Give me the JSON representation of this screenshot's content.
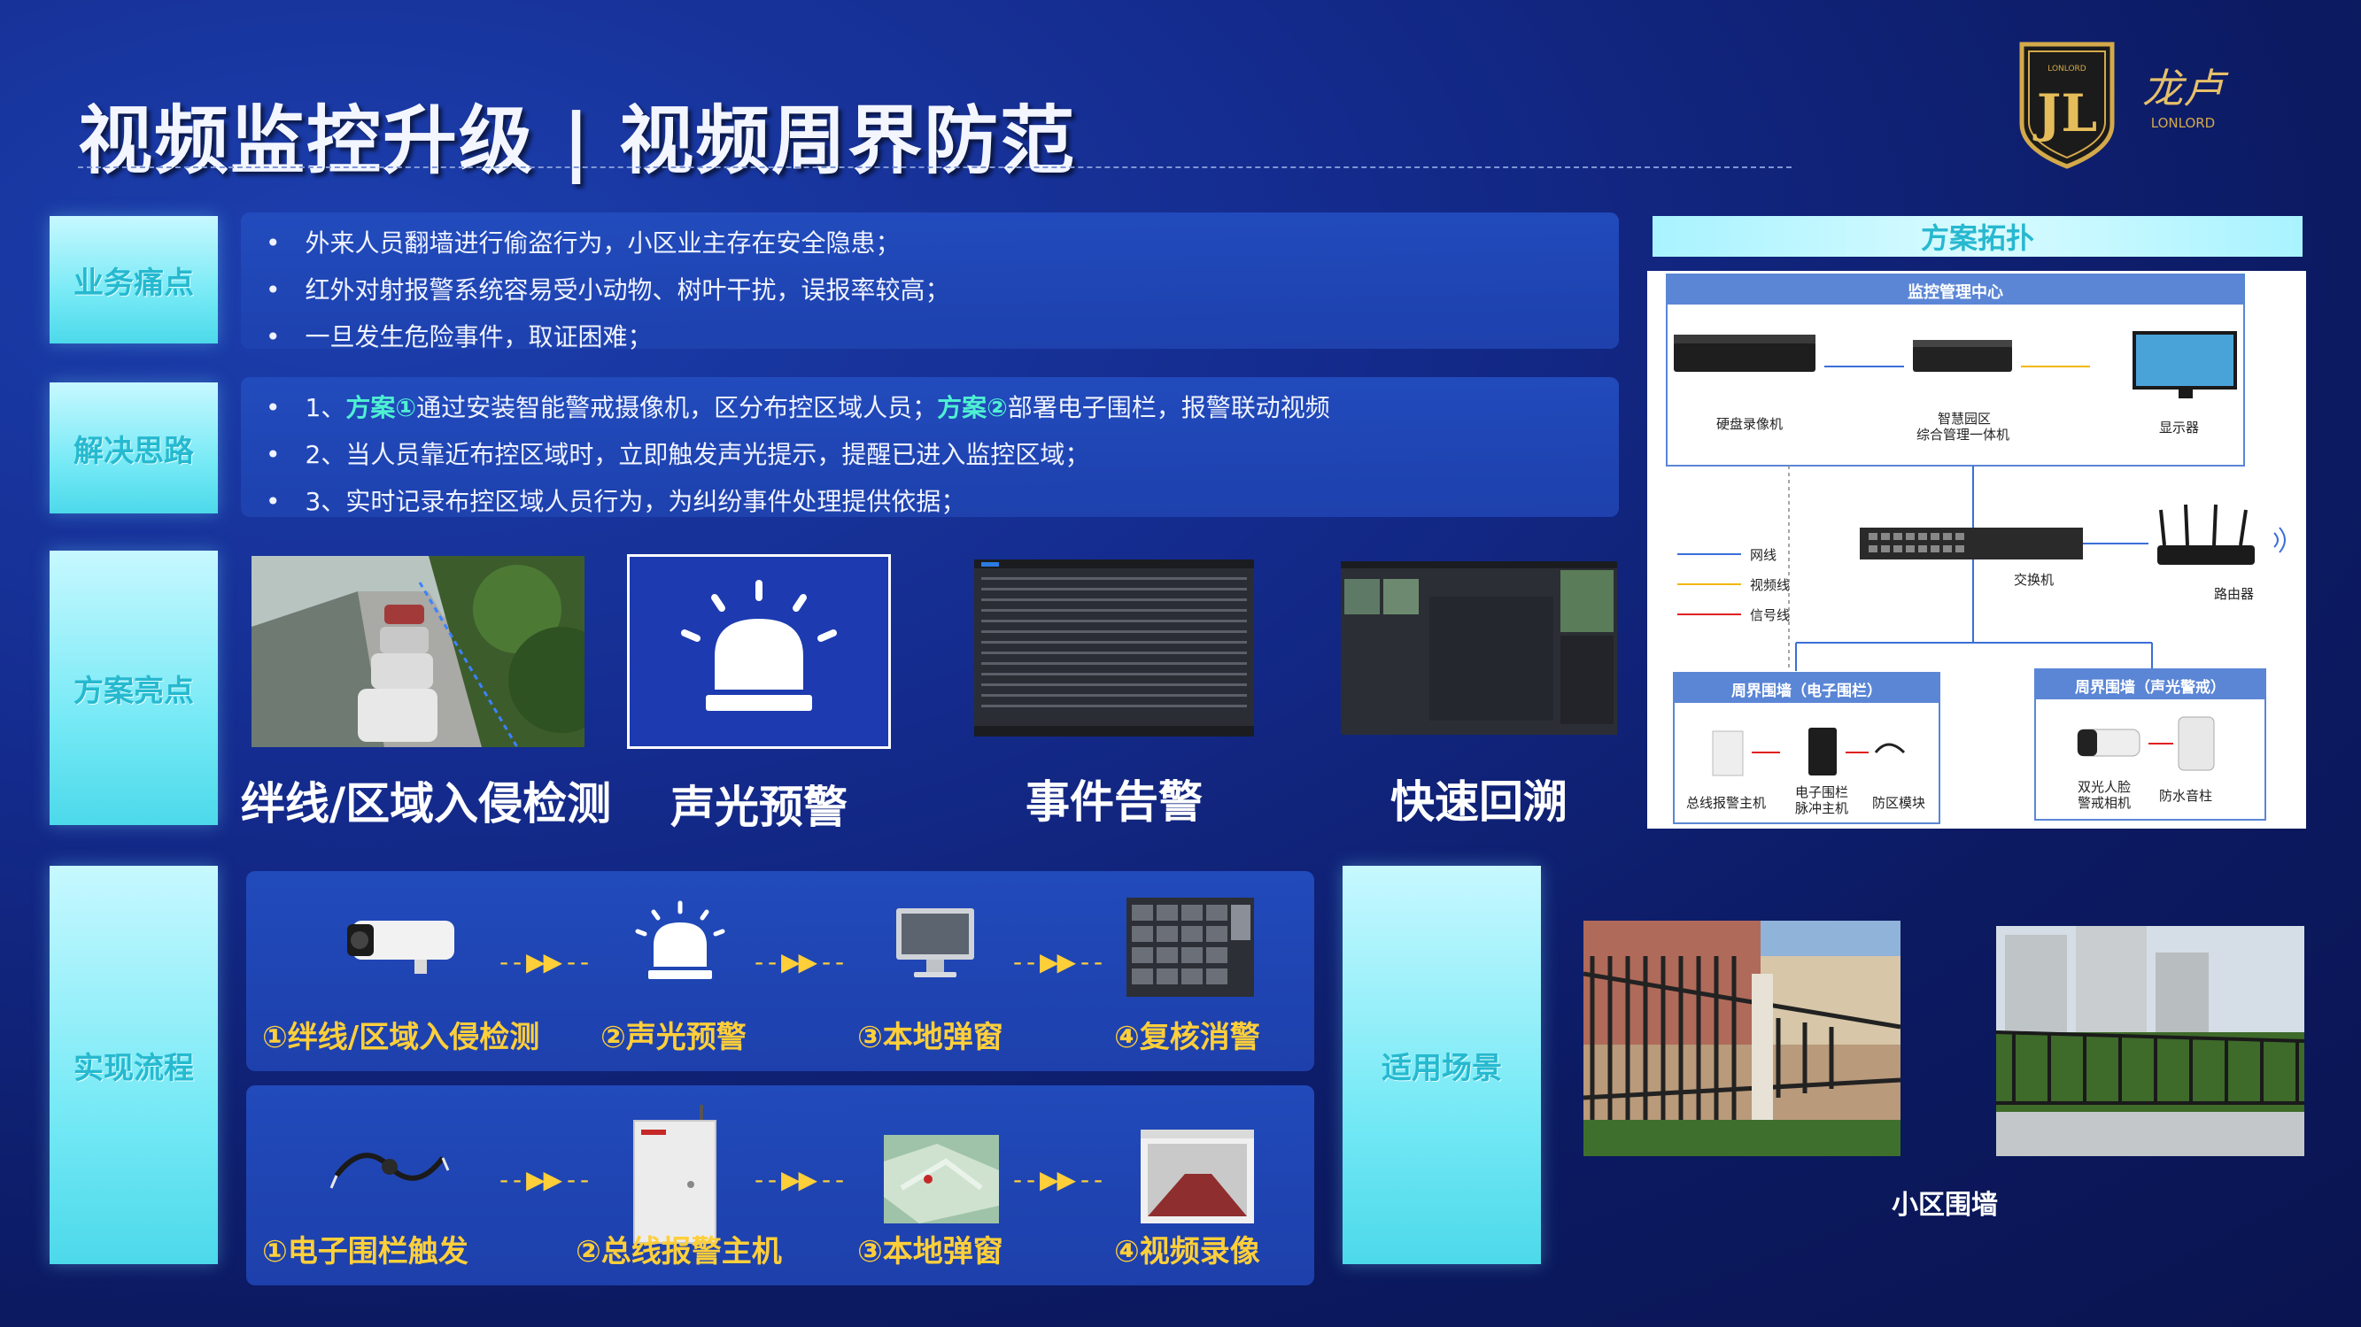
{
  "title": "视频监控升级 | 视频周界防范",
  "logo": {
    "mark": "JL",
    "brand_top": "LONLORD",
    "brand_cn": "龙卢",
    "brand_bottom": "LONLORD"
  },
  "pain_points": {
    "label": "业务痛点",
    "items": [
      "外来人员翻墙进行偷盗行为，小区业主存在安全隐患；",
      "红外对射报警系统容易受小动物、树叶干扰，误报率较高；",
      "一旦发生危险事件，取证困难；"
    ]
  },
  "solution": {
    "label": "解决思路",
    "item1_prefix": "1、",
    "item1_hl1": "方案①",
    "item1_mid": "通过安装智能警戒摄像机，区分布控区域人员；",
    "item1_hl2": "方案②",
    "item1_tail": "部署电子围栏，报警联动视频",
    "item2": "2、当人员靠近布控区域时，立即触发声光提示，提醒已进入监控区域；",
    "item3": "3、实时记录布控区域人员行为，为纠纷事件处理提供依据；"
  },
  "highlights": {
    "label": "方案亮点",
    "items": [
      "绊线/区域入侵检测",
      "声光预警",
      "事件告警",
      "快速回溯"
    ]
  },
  "process": {
    "label": "实现流程",
    "row1": [
      "①绊线/区域入侵检测",
      "②声光预警",
      "③本地弹窗",
      "④复核消警"
    ],
    "row2": [
      "①电子围栏触发",
      "②总线报警主机",
      "③本地弹窗",
      "④视频录像"
    ],
    "arrow": "- - ▶▶ - -"
  },
  "scenes": {
    "label": "适用场景",
    "caption": "小区围墙"
  },
  "topology": {
    "header": "方案拓扑",
    "center_title": "监控管理中心",
    "nvr": "硬盘录像机",
    "platform_line1": "智慧园区",
    "platform_line2": "综合管理一体机",
    "display": "显示器",
    "switch": "交换机",
    "router": "路由器",
    "legend": [
      "网线",
      "视频线",
      "信号线"
    ],
    "left_box_title": "周界围墙（电子围栏）",
    "left_items": [
      "总线报警主机",
      "电子围栏\n脉冲主机",
      "防区模块"
    ],
    "right_box_title": "周界围墙（声光警戒）",
    "right_items": [
      "双光人脸\n警戒相机",
      "防水音柱"
    ],
    "colors": {
      "network": "#3b6fd8",
      "video": "#f2b705",
      "signal": "#e02020",
      "accent": "#4ef0d2",
      "flow": "#ffcf3a"
    }
  }
}
